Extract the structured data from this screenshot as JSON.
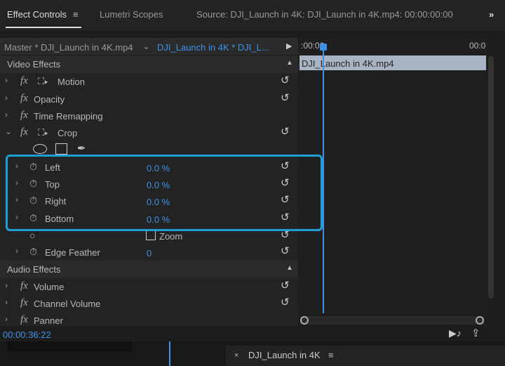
{
  "tabs": {
    "effect_controls": "Effect Controls",
    "lumetri": "Lumetri Scopes",
    "source": "Source: DJI_Launch in 4K: DJI_Launch in 4K.mp4: 00:00:00:00",
    "more": "»",
    "menu": "≡"
  },
  "clip": {
    "master": "Master * DJI_Launch in 4K.mp4",
    "sequence": "DJI_Launch in 4K * DJI_L...",
    "timeline_start": ":00:00",
    "timeline_end": "00:0",
    "clip_name": "DJI_Launch in 4K.mp4"
  },
  "video_effects": "Video Effects",
  "motion": "Motion",
  "opacity": "Opacity",
  "time_remap": "Time Remapping",
  "crop": "Crop",
  "crop_params": [
    {
      "label": "Left",
      "value": "0.0 %"
    },
    {
      "label": "Top",
      "value": "0.0 %"
    },
    {
      "label": "Right",
      "value": "0.0 %"
    },
    {
      "label": "Bottom",
      "value": "0.0 %"
    }
  ],
  "zoom": "Zoom",
  "edge_feather": "Edge Feather",
  "edge_feather_value": "0",
  "audio_effects": "Audio Effects",
  "volume": "Volume",
  "channel_volume": "Channel Volume",
  "panner": "Panner",
  "timecode": "00:00:36:22",
  "bottom_tab": "DJI_Launch in 4K",
  "bottom_close": "×",
  "highlight_color": "#1e9fd6"
}
